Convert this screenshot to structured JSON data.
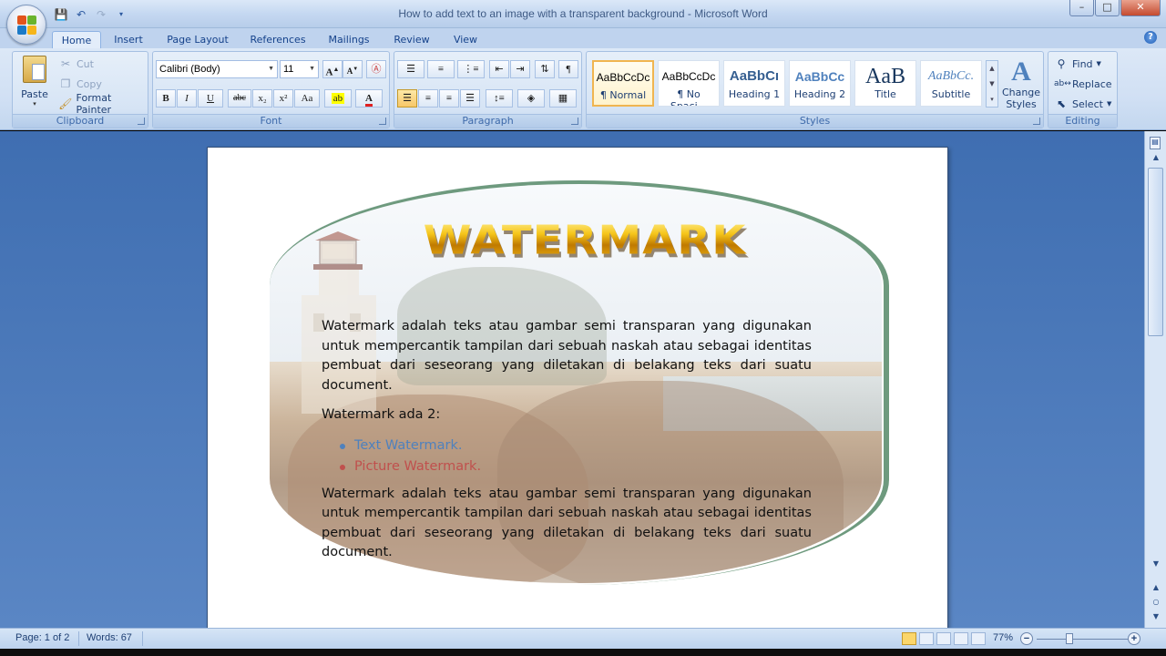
{
  "window": {
    "title": "How to add text to an image with a transparent background - Microsoft Word",
    "minimize": "–",
    "maximize": "□",
    "close": "✕"
  },
  "tabs": [
    "Home",
    "Insert",
    "Page Layout",
    "References",
    "Mailings",
    "Review",
    "View"
  ],
  "help": "?",
  "clipboard": {
    "paste": "Paste",
    "cut": "Cut",
    "copy": "Copy",
    "format_painter": "Format Painter",
    "label": "Clipboard"
  },
  "font": {
    "name": "Calibri (Body)",
    "size": "11",
    "label": "Font",
    "buttons": {
      "bold": "B",
      "italic": "I",
      "underline": "U",
      "strike": "abc",
      "sub": "x₂",
      "sup": "x²",
      "case": "Aa",
      "grow": "A",
      "shrink": "A"
    }
  },
  "paragraph": {
    "label": "Paragraph"
  },
  "styles": {
    "label": "Styles",
    "items": [
      {
        "sample": "AaBbCcDc",
        "name": "¶ Normal"
      },
      {
        "sample": "AaBbCcDc",
        "name": "¶ No Spaci..."
      },
      {
        "sample": "AaBbCı",
        "name": "Heading 1"
      },
      {
        "sample": "AaBbCc",
        "name": "Heading 2"
      },
      {
        "sample": "AaB",
        "name": "Title"
      },
      {
        "sample": "AaBbCc.",
        "name": "Subtitle"
      }
    ],
    "change_styles": "Change Styles"
  },
  "editing": {
    "find": "Find",
    "replace": "Replace",
    "select": "Select",
    "label": "Editing"
  },
  "document": {
    "wordart": "WATERMARK",
    "para1": "Watermark adalah teks atau gambar semi transparan yang digunakan untuk mempercantik tampilan dari sebuah naskah atau sebagai identitas pembuat dari seseorang yang diletakan di belakang teks dari suatu document.",
    "para2": "Watermark ada 2:",
    "bullets": [
      "Text Watermark.",
      "Picture Watermark."
    ],
    "para3": "Watermark adalah teks atau gambar semi transparan yang digunakan untuk mempercantik tampilan dari sebuah naskah atau sebagai identitas pembuat dari seseorang yang diletakan di belakang teks dari suatu document."
  },
  "status": {
    "page": "Page: 1 of 2",
    "words": "Words: 67",
    "zoom": "77%"
  },
  "colors": {
    "accent_blue": "#4f81bd",
    "accent_red": "#c0504d",
    "shape_border": "#6e9a7e"
  }
}
